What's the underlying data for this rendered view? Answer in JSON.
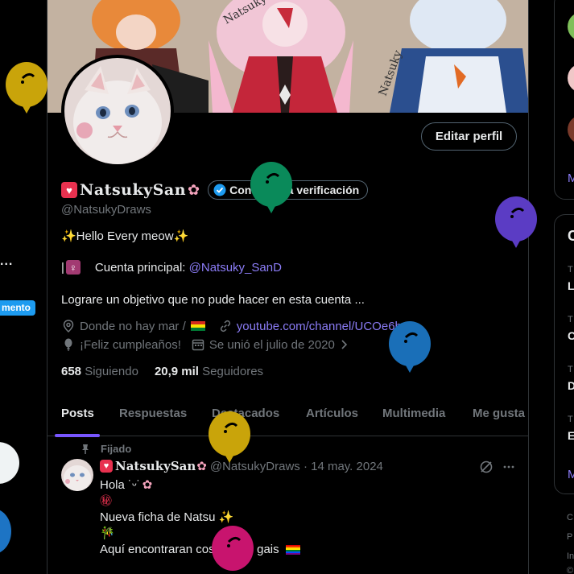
{
  "left": {
    "ellipsis": "...",
    "pill_label": "mento"
  },
  "profile": {
    "edit_label": "Editar perfil",
    "display_name": "NatsukySan",
    "verify_label": "Consigue la verificación",
    "handle": "@NatsukyDraws",
    "bio_line1": "✨Hello Every meow✨",
    "bio_line2_prefix": "Cuenta principal: ",
    "bio_line2_link": "@Natsuky_SanD",
    "bio_line3": "Lograre un objetivo que no pude hacer en esta cuenta ...",
    "location": "Donde no hay mar /",
    "website": "youtube.com/channel/UCOe6h...",
    "birthday": "¡Feliz cumpleaños!",
    "joined": "Se unió el julio de 2020",
    "following_count": "658",
    "following_label": "Siguiendo",
    "followers_count": "20,9 mil",
    "followers_label": "Seguidores"
  },
  "tabs": [
    "Posts",
    "Respuestas",
    "Destacados",
    "Artículos",
    "Multimedia",
    "Me gusta"
  ],
  "post": {
    "pinned_label": "Fijado",
    "author": "NatsukySan",
    "meta": "@NatsukyDraws · 14 may. 2024",
    "lines": [
      "Hola ˙ᵕ˙",
      "㊙",
      "Nueva ficha de Natsu ✨",
      "🎋",
      "Aquí encontraran cosas muy gais"
    ]
  },
  "right": {
    "link1": "M",
    "small1": "T",
    "row1": "L",
    "small2": "T",
    "row2": "C",
    "small3": "T",
    "row3": "D",
    "small4": "T",
    "row4": "E",
    "link2": "M",
    "title2": "C",
    "foot1": "C",
    "foot2": "P",
    "foot3": "In",
    "foot4": "©"
  },
  "colors": {
    "accent": "#7856ff",
    "link": "#8b7cf6",
    "verified_blue": "#1d9bf0",
    "balloon_yellow": "#c9a40a",
    "balloon_green": "#0a8a5a",
    "balloon_purple": "#5b3cc4",
    "balloon_blue": "#1a6fb8",
    "balloon_magenta": "#c8146e"
  }
}
